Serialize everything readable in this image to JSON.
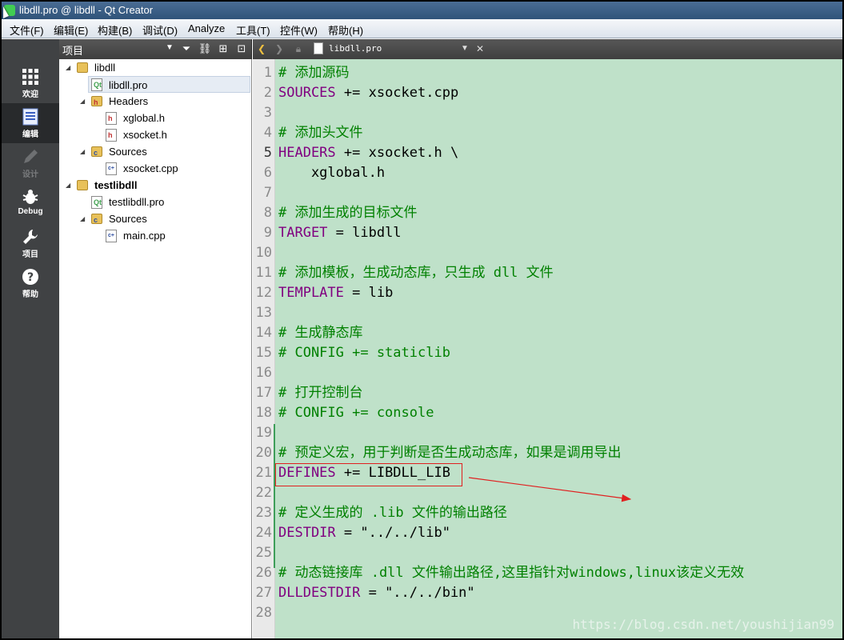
{
  "window": {
    "title": "libdll.pro @ libdll - Qt Creator"
  },
  "menu": [
    "文件(F)",
    "编辑(E)",
    "构建(B)",
    "调试(D)",
    "Analyze",
    "工具(T)",
    "控件(W)",
    "帮助(H)"
  ],
  "modes": [
    {
      "label": "欢迎",
      "icon": "grid-icon",
      "state": "normal"
    },
    {
      "label": "编辑",
      "icon": "edit-doc-icon",
      "state": "active"
    },
    {
      "label": "设计",
      "icon": "pencil-icon",
      "state": "disabled"
    },
    {
      "label": "Debug",
      "icon": "bug-icon",
      "state": "normal"
    },
    {
      "label": "项目",
      "icon": "wrench-icon",
      "state": "normal"
    },
    {
      "label": "帮助",
      "icon": "help-icon",
      "state": "normal"
    }
  ],
  "project_panel": {
    "title": "项目",
    "tree": [
      {
        "label": "libdll",
        "kind": "project"
      },
      {
        "label": "libdll.pro",
        "kind": "pro-file",
        "selected": true
      },
      {
        "label": "Headers",
        "kind": "folder"
      },
      {
        "label": "xglobal.h",
        "kind": "header"
      },
      {
        "label": "xsocket.h",
        "kind": "header"
      },
      {
        "label": "Sources",
        "kind": "folder"
      },
      {
        "label": "xsocket.cpp",
        "kind": "source"
      },
      {
        "label": "testlibdll",
        "kind": "project",
        "bold": true
      },
      {
        "label": "testlibdll.pro",
        "kind": "pro-file"
      },
      {
        "label": "Sources",
        "kind": "folder"
      },
      {
        "label": "main.cpp",
        "kind": "source"
      }
    ]
  },
  "editor": {
    "file_name": "libdll.pro",
    "current_line": 5,
    "lines": [
      "# 添加源码",
      "SOURCES += xsocket.cpp",
      "",
      "# 添加头文件",
      "HEADERS += xsocket.h \\",
      "    xglobal.h",
      "",
      "# 添加生成的目标文件",
      "TARGET = libdll",
      "",
      "# 添加模板，生成动态库，只生成 dll 文件",
      "TEMPLATE = lib",
      "",
      "# 生成静态库",
      "# CONFIG += staticlib",
      "",
      "# 打开控制台",
      "# CONFIG += console",
      "",
      "# 预定义宏，用于判断是否生成动态库，如果是调用导出",
      "DEFINES += LIBDLL_LIB",
      "",
      "# 定义生成的 .lib 文件的输出路径",
      "DESTDIR = \"../../lib\"",
      "",
      "# 动态链接库 .dll 文件输出路径,这里指针对windows,linux该定义无效",
      "DLLDESTDIR = \"../../bin\"",
      ""
    ],
    "highlighted_line": 21
  },
  "watermark": "https://blog.csdn.net/youshijian99",
  "colors": {
    "editor_bg": "#bfe1c9",
    "comment": "#008000",
    "variable": "#800080",
    "annotation": "#e02020"
  }
}
